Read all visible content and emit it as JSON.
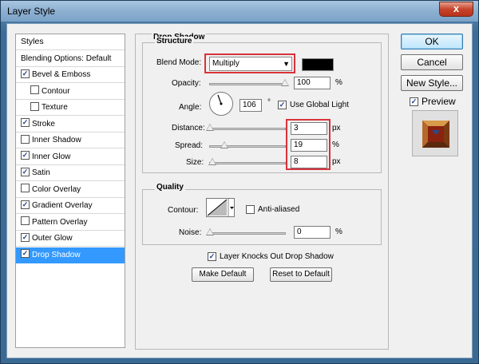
{
  "window": {
    "title": "Layer Style",
    "close_glyph": "x"
  },
  "styles_list": {
    "items": [
      {
        "label": "Styles",
        "checkbox": null,
        "indent": false,
        "selected": false
      },
      {
        "label": "Blending Options: Default",
        "checkbox": null,
        "indent": false,
        "selected": false
      },
      {
        "label": "Bevel & Emboss",
        "checkbox": true,
        "indent": false,
        "selected": false
      },
      {
        "label": "Contour",
        "checkbox": false,
        "indent": true,
        "selected": false
      },
      {
        "label": "Texture",
        "checkbox": false,
        "indent": true,
        "selected": false
      },
      {
        "label": "Stroke",
        "checkbox": true,
        "indent": false,
        "selected": false
      },
      {
        "label": "Inner Shadow",
        "checkbox": false,
        "indent": false,
        "selected": false
      },
      {
        "label": "Inner Glow",
        "checkbox": true,
        "indent": false,
        "selected": false
      },
      {
        "label": "Satin",
        "checkbox": true,
        "indent": false,
        "selected": false
      },
      {
        "label": "Color Overlay",
        "checkbox": false,
        "indent": false,
        "selected": false
      },
      {
        "label": "Gradient Overlay",
        "checkbox": true,
        "indent": false,
        "selected": false
      },
      {
        "label": "Pattern Overlay",
        "checkbox": false,
        "indent": false,
        "selected": false
      },
      {
        "label": "Outer Glow",
        "checkbox": true,
        "indent": false,
        "selected": false
      },
      {
        "label": "Drop Shadow",
        "checkbox": true,
        "indent": false,
        "selected": true
      }
    ]
  },
  "drop_shadow": {
    "group_title": "Drop Shadow",
    "structure_title": "Structure",
    "blend_mode_label": "Blend Mode:",
    "blend_mode_value": "Multiply",
    "blend_color": "#000000",
    "opacity_label": "Opacity:",
    "opacity_value": "100",
    "opacity_unit": "%",
    "opacity_level": 1.0,
    "angle_label": "Angle:",
    "angle_value": "106",
    "angle_unit": "°",
    "use_global_light_label": "Use Global Light",
    "use_global_light": true,
    "distance_label": "Distance:",
    "distance_value": "3",
    "distance_unit": "px",
    "distance_level": 0.0,
    "spread_label": "Spread:",
    "spread_value": "19",
    "spread_unit": "%",
    "spread_level": 0.19,
    "size_label": "Size:",
    "size_value": "8",
    "size_unit": "px",
    "size_level": 0.03
  },
  "quality": {
    "title": "Quality",
    "contour_label": "Contour:",
    "anti_aliased_label": "Anti-aliased",
    "anti_aliased": false,
    "noise_label": "Noise:",
    "noise_value": "0",
    "noise_unit": "%",
    "noise_level": 0.0,
    "knocks_out_label": "Layer Knocks Out Drop Shadow",
    "knocks_out": true,
    "make_default_label": "Make Default",
    "reset_default_label": "Reset to Default"
  },
  "actions": {
    "ok_label": "OK",
    "cancel_label": "Cancel",
    "new_style_label": "New Style...",
    "preview_label": "Preview",
    "preview_checked": true
  },
  "colors": {
    "highlight": "#d9323b",
    "selection": "#3399ff"
  }
}
